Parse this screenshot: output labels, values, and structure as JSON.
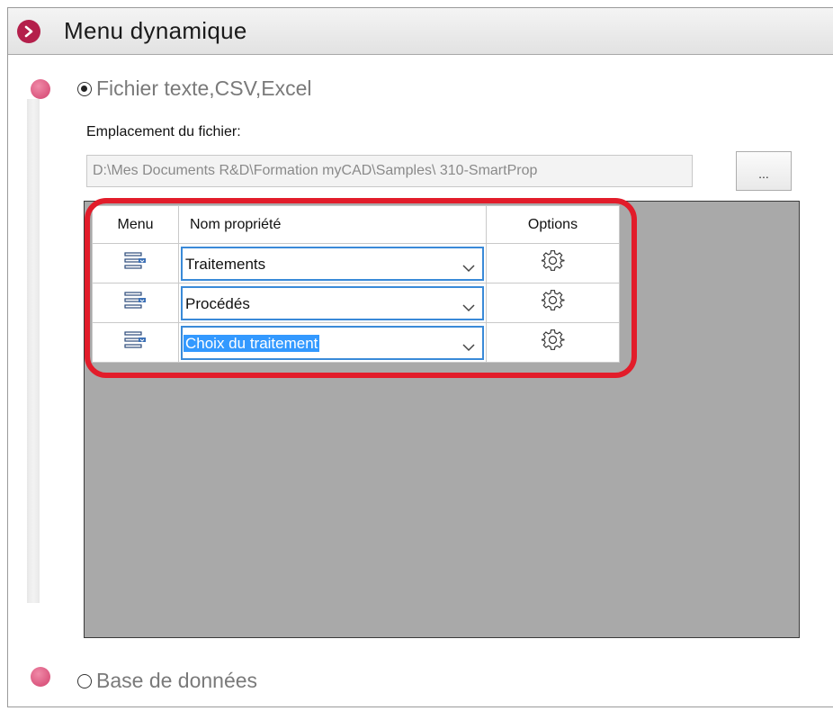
{
  "header": {
    "title": "Menu dynamique"
  },
  "options": {
    "file_source_label": "Fichier texte,CSV,Excel",
    "database_label": "Base de données"
  },
  "file_location": {
    "label": "Emplacement du fichier:",
    "path": "D:\\Mes Documents R&D\\Formation myCAD\\Samples\\ 310-SmartProp",
    "browse_label": "..."
  },
  "table": {
    "headers": [
      "Menu",
      "Nom propriété",
      "Options"
    ],
    "rows": [
      {
        "property": "Traitements",
        "selected": false
      },
      {
        "property": "Procédés",
        "selected": false
      },
      {
        "property": "Choix du traitement",
        "selected": true
      }
    ]
  },
  "colors": {
    "accent": "#b41f4b",
    "highlight": "#e21c2a",
    "selection": "#3399ff",
    "combo_border": "#3a8ad8"
  },
  "icons": {
    "header": "chevron-right-icon",
    "menu": "menu-list-icon",
    "options": "gear-icon",
    "dropdown": "chevron-down-icon"
  }
}
